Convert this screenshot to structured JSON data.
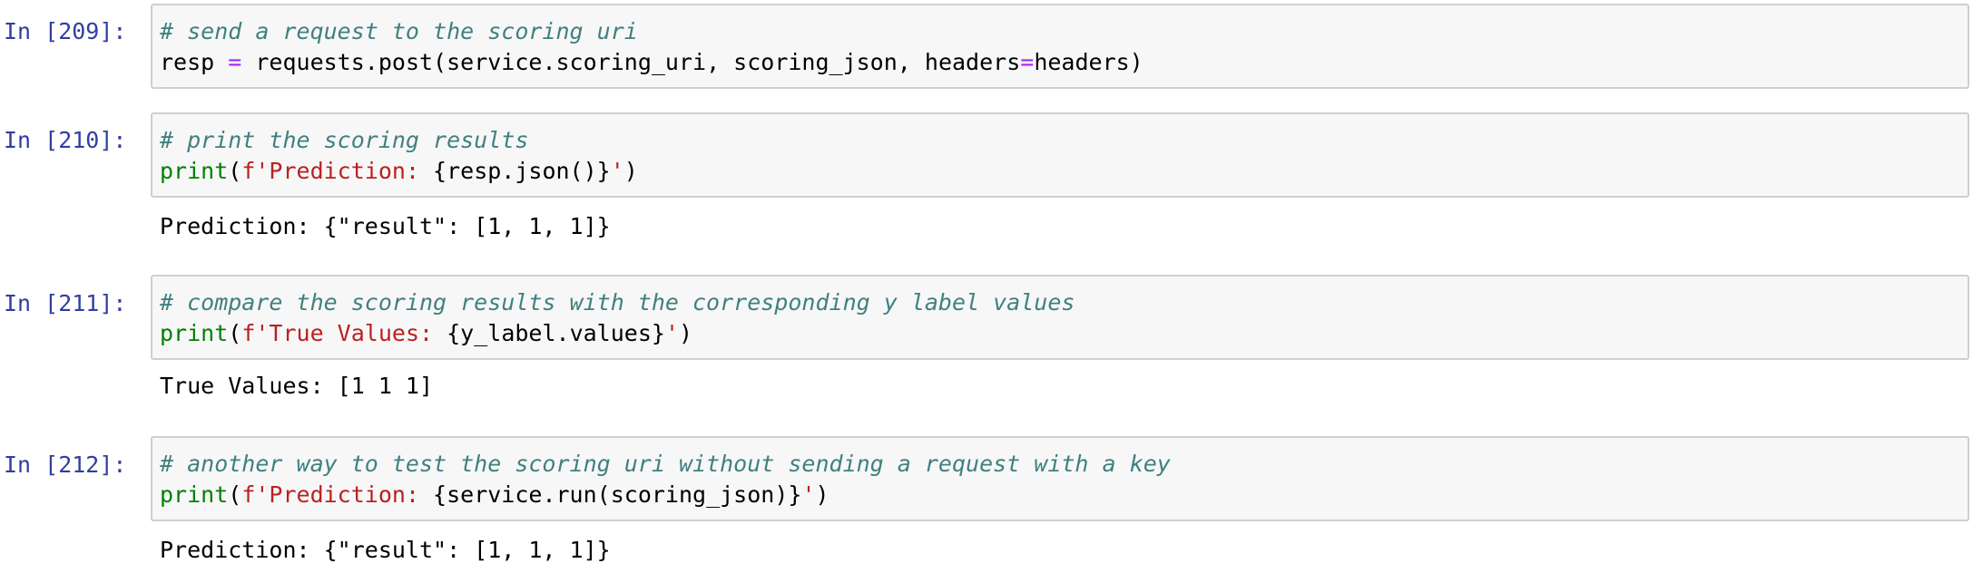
{
  "cells": [
    {
      "prompt": "In [209]:",
      "comment": "# send a request to the scoring uri",
      "code2_a": "resp ",
      "code2_op": "=",
      "code2_b": " requests.post(service.scoring_uri, scoring_json, headers",
      "code2_op2": "=",
      "code2_c": "headers)"
    },
    {
      "prompt": "In [210]:",
      "comment": "# print the scoring results",
      "fn": "print",
      "paren_open": "(",
      "str_open": "f'Prediction: ",
      "expr": "{resp.json()}",
      "str_close": "'",
      "paren_close": ")",
      "output": "Prediction: {\"result\": [1, 1, 1]}"
    },
    {
      "prompt": "In [211]:",
      "comment": "# compare the scoring results with the corresponding y label values",
      "fn": "print",
      "paren_open": "(",
      "str_open": "f'True Values: ",
      "expr": "{y_label.values}",
      "str_close": "'",
      "paren_close": ")",
      "output": "True Values: [1 1 1]"
    },
    {
      "prompt": "In [212]:",
      "comment": "# another way to test the scoring uri without sending a request with a key",
      "fn": "print",
      "paren_open": "(",
      "str_open": "f'Prediction: ",
      "expr": "{service.run(scoring_json)}",
      "str_close": "'",
      "paren_close": ")",
      "output": "Prediction: {\"result\": [1, 1, 1]}"
    }
  ],
  "colors": {
    "prompt": "#303f9f",
    "comment": "#408080",
    "builtin": "#008000",
    "string": "#ba2121",
    "operator": "#aa22ff",
    "cell_bg": "#f7f7f7",
    "cell_border": "#cfcfcf"
  }
}
